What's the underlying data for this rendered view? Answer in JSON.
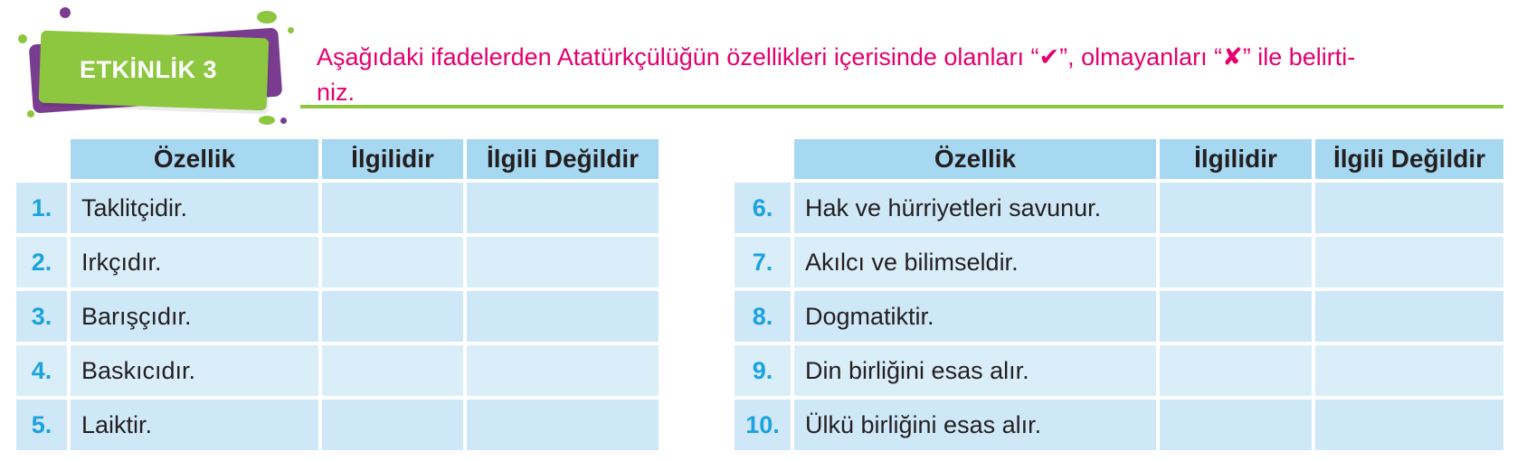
{
  "activity": {
    "badge_label": "ETKİNLİK 3",
    "instruction_part1": "Aşağıdaki ifadelerden Atatürkçülüğün özellikleri içerisinde olanları “",
    "check_mark": "✔",
    "instruction_part2": "”, olmayanları “",
    "cross_mark": "✘",
    "instruction_part3": "” ile belirti-",
    "instruction_line2": "niz."
  },
  "colors": {
    "accent_pink": "#e4006e",
    "badge_green": "#8dc63f",
    "badge_purple": "#7a3c8f",
    "header_blue": "#a7d8f2",
    "cell_blue": "#daeefa",
    "number_blue": "#1aa3dd"
  },
  "tables": [
    {
      "headers": [
        "Özellik",
        "İlgilidir",
        "İlgili Değildir"
      ],
      "rows": [
        {
          "num": "1.",
          "text": "Taklitçidir."
        },
        {
          "num": "2.",
          "text": "Irkçıdır."
        },
        {
          "num": "3.",
          "text": "Barışçıdır."
        },
        {
          "num": "4.",
          "text": "Baskıcıdır."
        },
        {
          "num": "5.",
          "text": "Laiktir."
        }
      ]
    },
    {
      "headers": [
        "Özellik",
        "İlgilidir",
        "İlgili Değildir"
      ],
      "rows": [
        {
          "num": "6.",
          "text": "Hak ve hürriyetleri savunur."
        },
        {
          "num": "7.",
          "text": "Akılcı ve bilimseldir."
        },
        {
          "num": "8.",
          "text": "Dogmatiktir."
        },
        {
          "num": "9.",
          "text": "Din birliğini esas alır."
        },
        {
          "num": "10.",
          "text": "Ülkü birliğini esas alır."
        }
      ]
    }
  ]
}
